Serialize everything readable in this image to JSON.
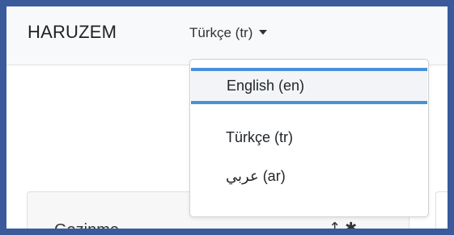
{
  "navbar": {
    "brand": "HARUZEM",
    "language_toggle": "Türkçe (tr)"
  },
  "dropdown": {
    "items": [
      {
        "label": "English (en)",
        "active": true
      },
      {
        "label": "Türkçe (tr)",
        "active": false
      },
      {
        "label": "عربي (ar)",
        "active": false
      }
    ]
  },
  "content": {
    "card_title": "Gezinme",
    "card_icons": "↥ ✱"
  },
  "colors": {
    "outer_border": "#3a5a9c",
    "active_item_border": "#4a90d9",
    "navbar_bg": "#f8f9fa"
  }
}
